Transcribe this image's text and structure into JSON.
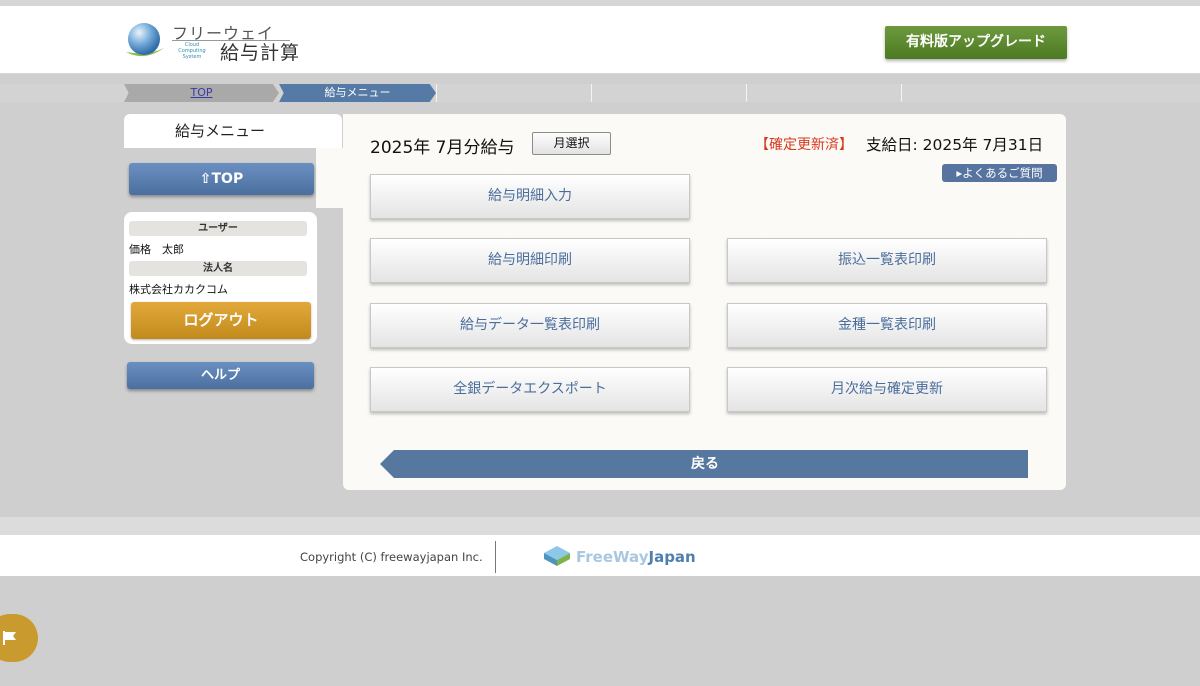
{
  "header": {
    "logo_top": "フリーウェイ",
    "logo_sub": "Cloud Computing System",
    "logo_main": "給与計算",
    "upgrade_label": "有料版アップグレード"
  },
  "breadcrumb": {
    "items": [
      "TOP",
      "給与メニュー"
    ]
  },
  "sidebar": {
    "title": "給与メニュー",
    "top_label": "TOP",
    "user_label": "ユーザー",
    "user_name": "価格　太郎",
    "company_label": "法人名",
    "company_name": "株式会社カカクコム",
    "logout_label": "ログアウト",
    "help_label": "ヘルプ"
  },
  "main": {
    "pay_title": "2025年 7月分給与",
    "month_select_label": "月選択",
    "status": "【確定更新済】",
    "payday": "支給日: 2025年 7月31日",
    "faq_label": "よくあるご質問",
    "menu": [
      "給与明細入力",
      "給与明細印刷",
      "振込一覧表印刷",
      "給与データ一覧表印刷",
      "金種一覧表印刷",
      "全銀データエクスポート",
      "月次給与確定更新"
    ],
    "back_label": "戻る"
  },
  "footer": {
    "copyright": "Copyright (C) freewayjapan Inc.",
    "brand_free": "FreeWay",
    "brand_japan": "Japan"
  },
  "colors": {
    "accent_blue": "#567aa6",
    "upgrade_green": "#5a8a2e",
    "logout_gold": "#d29c2b",
    "status_red": "#d63a1d"
  }
}
